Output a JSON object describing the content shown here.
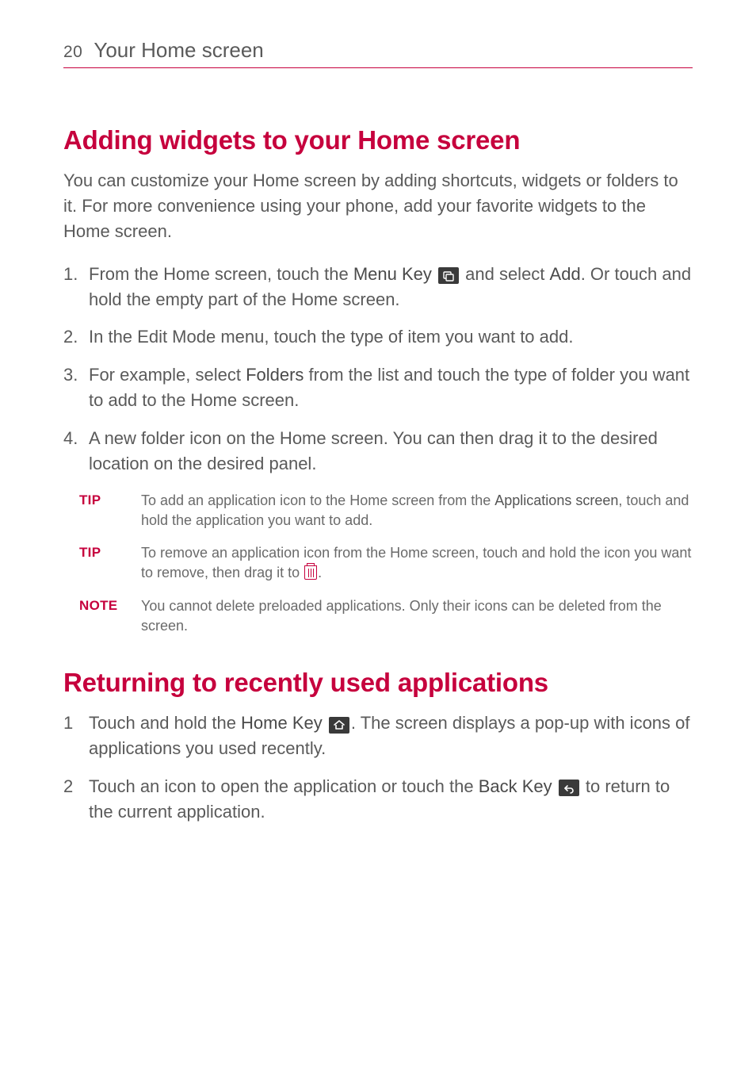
{
  "header": {
    "page_number": "20",
    "running_title": "Your Home screen"
  },
  "section1": {
    "heading": "Adding widgets to your Home screen",
    "intro": "You can customize your Home screen by adding shortcuts, widgets or folders to it. For more convenience using your phone, add your favorite widgets to the Home screen.",
    "steps": {
      "s1a": "From the Home screen, touch the ",
      "s1_menukey": "Menu Key",
      "s1b": " and select ",
      "s1_add": "Add",
      "s1c": ". Or touch and hold the empty part of the Home screen.",
      "s2": "In the Edit Mode menu, touch the type of item you want to add.",
      "s3a": "For example, select ",
      "s3_folders": "Folders",
      "s3b": " from the list and touch the type of folder you want to add to the Home screen.",
      "s4": "A new folder icon on the Home screen. You can then drag it to the desired location on the desired panel."
    },
    "tip1": {
      "label": "TIP",
      "a": "To add an application icon to the Home screen from the ",
      "apps": "Applications screen",
      "b": ", touch and hold the application you want to add."
    },
    "tip2": {
      "label": "TIP",
      "a": "To remove an application icon from the Home screen, touch and hold the icon you want to remove, then drag it to ",
      "b": "."
    },
    "note": {
      "label": "NOTE",
      "body": "You cannot delete preloaded applications. Only their icons can be deleted from the screen."
    }
  },
  "section2": {
    "heading": "Returning to recently used applications",
    "steps": {
      "s1a": "Touch and hold the ",
      "s1_homekey": "Home Key",
      "s1b": ". The screen displays a pop-up with icons of applications you used recently.",
      "s2a": "Touch an icon to open the application or touch the ",
      "s2_backkey": "Back Key",
      "s2b": " to return to the current application."
    }
  }
}
